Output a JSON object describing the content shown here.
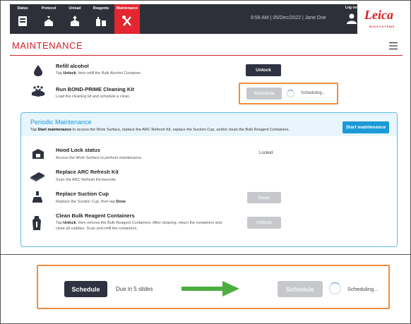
{
  "header": {
    "tabs": [
      {
        "label": "Status",
        "icon": "status-icon",
        "active": false
      },
      {
        "label": "Protocol",
        "icon": "protocol-icon",
        "active": false
      },
      {
        "label": "Unload",
        "icon": "unload-icon",
        "active": false
      },
      {
        "label": "Reagents",
        "icon": "reagents-icon",
        "active": false
      },
      {
        "label": "Maintenance",
        "icon": "maintenance-icon",
        "active": true
      }
    ],
    "info": "9:58 AM  |  05/Dec/2022  |  Jane Doe",
    "logout_label": "Log out",
    "brand": {
      "name": "Leica",
      "sub": "BIOSYSTEMS"
    }
  },
  "page": {
    "title": "MAINTENANCE"
  },
  "tasks": {
    "refill": {
      "title": "Refill alcohol",
      "desc_pre": "Tap ",
      "desc_bold": "Unlock",
      "desc_post": ", then refill the Bulk Alcohol Container.",
      "button": "Unlock"
    },
    "bond_prime": {
      "title": "Run BOND-PRIME Cleaning Kit",
      "desc": "Load the cleaning kit and schedule a clean.",
      "button": "Schedule",
      "status": "Scheduling..."
    }
  },
  "periodic": {
    "title": "Periodic Maintenance",
    "desc_pre": "Tap ",
    "desc_bold": "Start maintenance",
    "desc_post": " to access the Work Surface, replace the ARC Refresh Kit, replace the Suction Cup, and/or clean the Bulk Reagent Containers.",
    "start_button": "Start maintenance",
    "items": {
      "hood": {
        "title": "Hood Lock status",
        "desc": "Access the Work Surface to perform maintenance.",
        "status": "Locked"
      },
      "arc": {
        "title": "Replace ARC Refresh Kit",
        "desc": "Scan the ARC Refresh Kit barcode."
      },
      "suction": {
        "title": "Replace Suction Cup",
        "desc_pre": "Replace the Suction Cup, then tap ",
        "desc_bold": "Done",
        "button": "Done"
      },
      "clean": {
        "title": "Clean Bulk Reagent Containers",
        "desc_pre": "Tap ",
        "desc_bold": "Unlock",
        "desc_post": ", then remove the Bulk Reagent Containers. After cleaning, return the containers and close all caddies. Scan and refill the containers.",
        "button": "Unlock"
      }
    }
  },
  "comparison": {
    "before": {
      "button": "Schedule",
      "due": "Due in 5 slides"
    },
    "after": {
      "button": "Schedule",
      "status": "Scheduling..."
    },
    "arrow_color": "#4cae3f"
  },
  "colors": {
    "brand_red": "#d21f26",
    "accent_blue": "#1a9ad6",
    "highlight_orange": "#f08d3c"
  }
}
